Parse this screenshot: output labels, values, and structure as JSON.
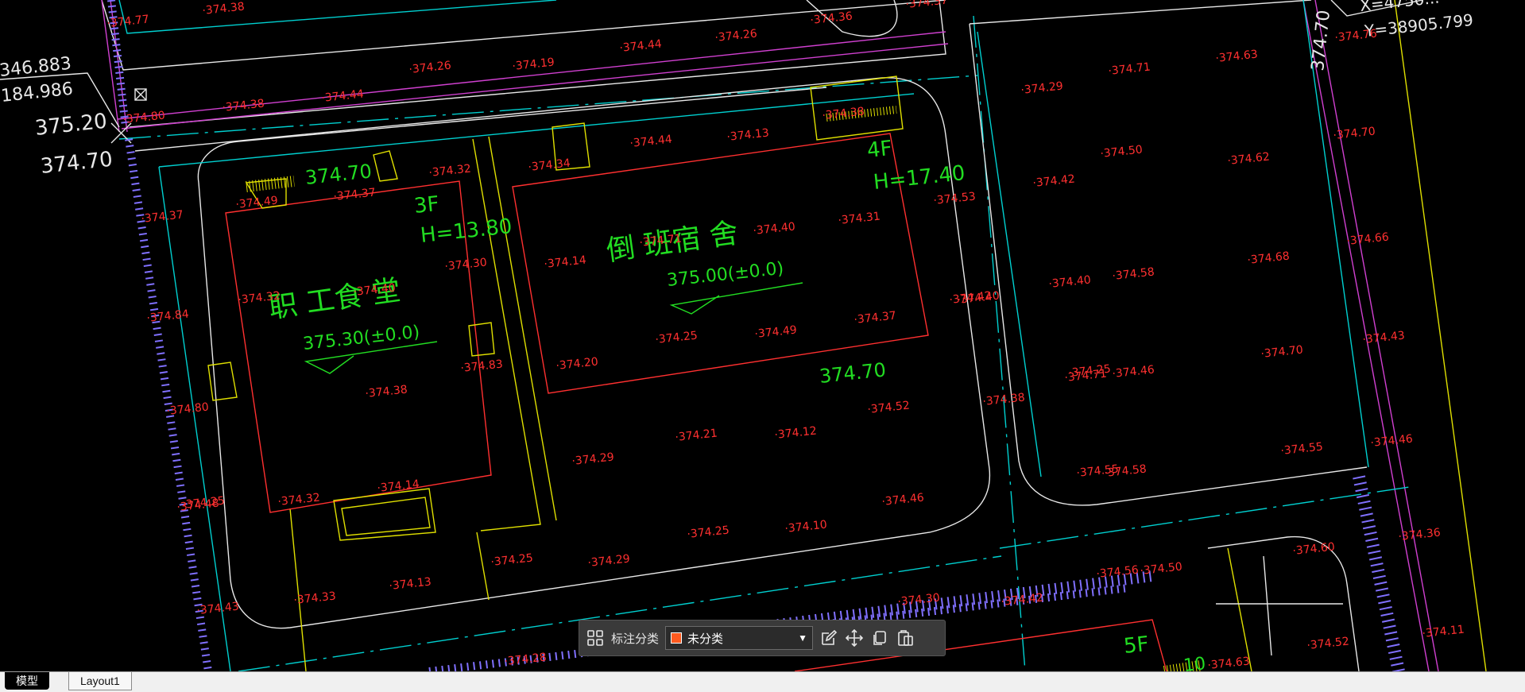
{
  "colors": {
    "background": "#000000",
    "red": "#ff3030",
    "green": "#22dd22",
    "cyan": "#00d0d0",
    "magenta": "#d040d0",
    "yellow": "#e0e000",
    "white": "#e8e8e8",
    "purple": "#8070ff",
    "accent_swatch": "#ff5a1f"
  },
  "drawing": {
    "coord_label": {
      "line1": "346.883",
      "line2": "184.986"
    },
    "corner_elev": {
      "upper": "375.20",
      "lower": "374.70"
    },
    "xy_label": {
      "x": "X=4750...",
      "y": "Y=38905.799"
    },
    "left_elev_top": "374.70",
    "right_elev_top": "374.70",
    "mid_elev": "374.70",
    "buildings": {
      "canteen": {
        "floors": "3F",
        "height": "H=13.80",
        "name": "职 工食 堂",
        "floor_level": "375.30(±0.0)"
      },
      "dorm": {
        "floors": "4F",
        "height": "H=17.40",
        "name": "倒 班宿  舍",
        "floor_level": "375.00(±0.0)"
      },
      "south": {
        "floors": "5F",
        "extra": "10"
      }
    },
    "spot_elevations": [
      "374.77",
      "374.38",
      "374.26",
      "374.19",
      "374.44",
      "374.26",
      "374.36",
      "374.37",
      "374.38",
      "374.44",
      "374.80",
      "374.37",
      "374.44",
      "374.13",
      "374.38",
      "374.32",
      "374.49",
      "374.37",
      "374.34",
      "374.29",
      "374.63",
      "374.71",
      "374.76",
      "374.53",
      "374.31",
      "374.40",
      "374.50",
      "374.62",
      "374.42",
      "374.70",
      "374.71",
      "374.14",
      "374.30",
      "374.32",
      "374.40",
      "374.66",
      "374.58",
      "374.68",
      "374.84",
      "374.25",
      "374.49",
      "374.37",
      "374.40",
      "374.42",
      "374.20",
      "374.83",
      "374.40",
      "374.25",
      "374.38",
      "374.52",
      "374.71",
      "374.46",
      "374.70",
      "374.43",
      "374.80",
      "374.21",
      "374.12",
      "374.29",
      "374.55",
      "374.46",
      "374.55",
      "374.58",
      "374.32",
      "374.14",
      "374.46",
      "374.25",
      "374.48",
      "374.25",
      "374.10",
      "374.25",
      "374.29",
      "374.38",
      "374.60",
      "374.50",
      "374.13",
      "374.33",
      "374.43",
      "374.36",
      "374.42",
      "374.52",
      "374.28",
      "374.11",
      "374.63",
      "374.30",
      "374.56"
    ]
  },
  "toolbar": {
    "label": "标注分类",
    "select_value": "未分类"
  },
  "tabs": [
    "模型",
    "Layout1"
  ]
}
